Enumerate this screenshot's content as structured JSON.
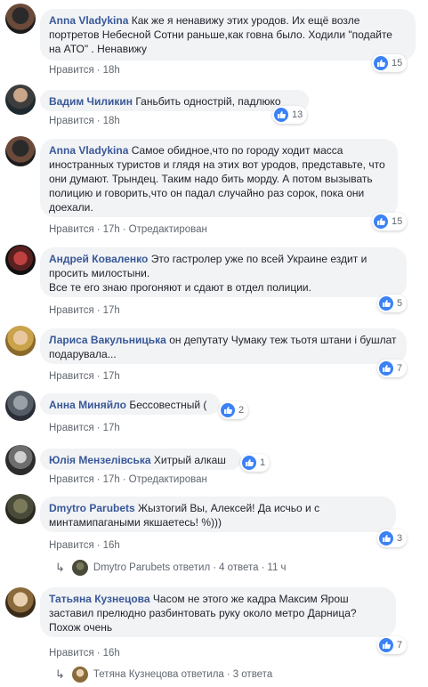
{
  "comments": [
    {
      "author": "Anna Vladykina",
      "text": "Как же я ненавижу этих уродов. Их ещё возле портретов Небесной Сотни раньше,как говна было. Ходили \"подайте на АТО\" . Ненавижу",
      "like": "Нравится",
      "time": "18h",
      "edited": "",
      "reactions": "15"
    },
    {
      "author": "Вадим Чиликин",
      "text": "Ганьбить однострій, падлюко",
      "like": "Нравится",
      "time": "18h",
      "edited": "",
      "reactions": "13"
    },
    {
      "author": "Anna Vladykina",
      "text": "Самое обидное,что по городу ходит масса иностранных туристов и глядя на этих вот уродов, представьте, что они думают. Трындец. Таким надо бить морду. А потом вызывать полицию и говорить,что он падал случайно раз сорок, пока они доехали.",
      "like": "Нравится",
      "time": "17h",
      "edited": "Отредактирован",
      "reactions": "15"
    },
    {
      "author": "Андрей Коваленко",
      "text": "Это гастролер уже по всей Украине ездит и просить милостыни.\nВсе те его знаю прогоняют и сдают в отдел полиции.",
      "like": "Нравится",
      "time": "17h",
      "edited": "",
      "reactions": "5"
    },
    {
      "author": "Лариса Вакульницька",
      "text": "он депутату Чумаку теж тьотя штани і бушлат подарувала...",
      "like": "Нравится",
      "time": "17h",
      "edited": "",
      "reactions": "7"
    },
    {
      "author": "Анна Миняйло",
      "text": "Бессовестный (",
      "like": "Нравится",
      "time": "17h",
      "edited": "",
      "reactions": "2"
    },
    {
      "author": "Юлія Мензелівська",
      "text": "Хитрый алкаш",
      "like": "Нравится",
      "time": "17h",
      "edited": "Отредактирован",
      "reactions": "1"
    },
    {
      "author": "Dmytro Parubets",
      "text": "Жызтогий Вы, Алексей! Да исчьо и с минтамипагаными якшаетесь! %)))",
      "like": "Нравится",
      "time": "16h",
      "edited": "",
      "reactions": "3",
      "reply_who": "Dmytro Parubets ответил",
      "reply_count": "4 ответа",
      "reply_time": "11 ч"
    },
    {
      "author": "Татьяна Кузнецова",
      "text": "Часом не этого же кадра Максим Ярош заставил прелюдно разбинтовать руку около метро Дарница? Похож очень",
      "like": "Нравится",
      "time": "16h",
      "edited": "",
      "reactions": "7",
      "reply_who": "Тетяна Кузнецова ответила",
      "reply_count": "3 ответа"
    }
  ],
  "icons": {
    "like": "thumbs-up-icon",
    "reply": "reply-arrow-icon"
  },
  "colors": {
    "link": "#385898",
    "bubble": "#f2f3f5",
    "like_badge": "#3b82f6"
  }
}
